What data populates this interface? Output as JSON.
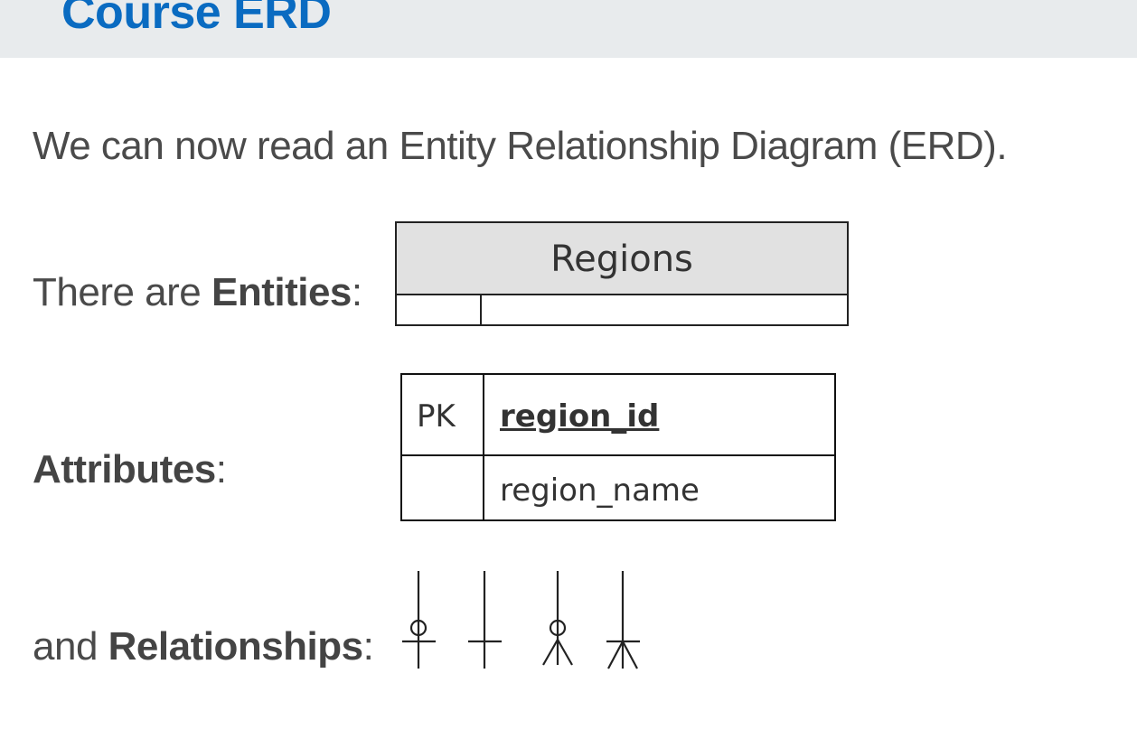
{
  "header": {
    "title": "Course ERD"
  },
  "intro": "We can now read an Entity Relationship Diagram (ERD).",
  "rows": {
    "entities": {
      "prefix": "There are ",
      "bold": "Entities",
      "suffix": ":"
    },
    "attributes": {
      "prefix": "",
      "bold": "Attributes",
      "suffix": ":"
    },
    "relationships": {
      "prefix": "and ",
      "bold": "Relationships",
      "suffix": ":"
    }
  },
  "entity": {
    "name": "Regions"
  },
  "attributes_table": {
    "key_label": "PK",
    "key_field": "region_id",
    "field": "region_name"
  },
  "relationship_symbols": [
    "zero-or-one-icon",
    "exactly-one-icon",
    "zero-or-many-icon",
    "one-or-many-icon"
  ],
  "colors": {
    "header_bg": "#e8ebed",
    "title": "#0a6bc1",
    "text": "#4a4a4a",
    "entity_head": "#e1e1e1"
  }
}
